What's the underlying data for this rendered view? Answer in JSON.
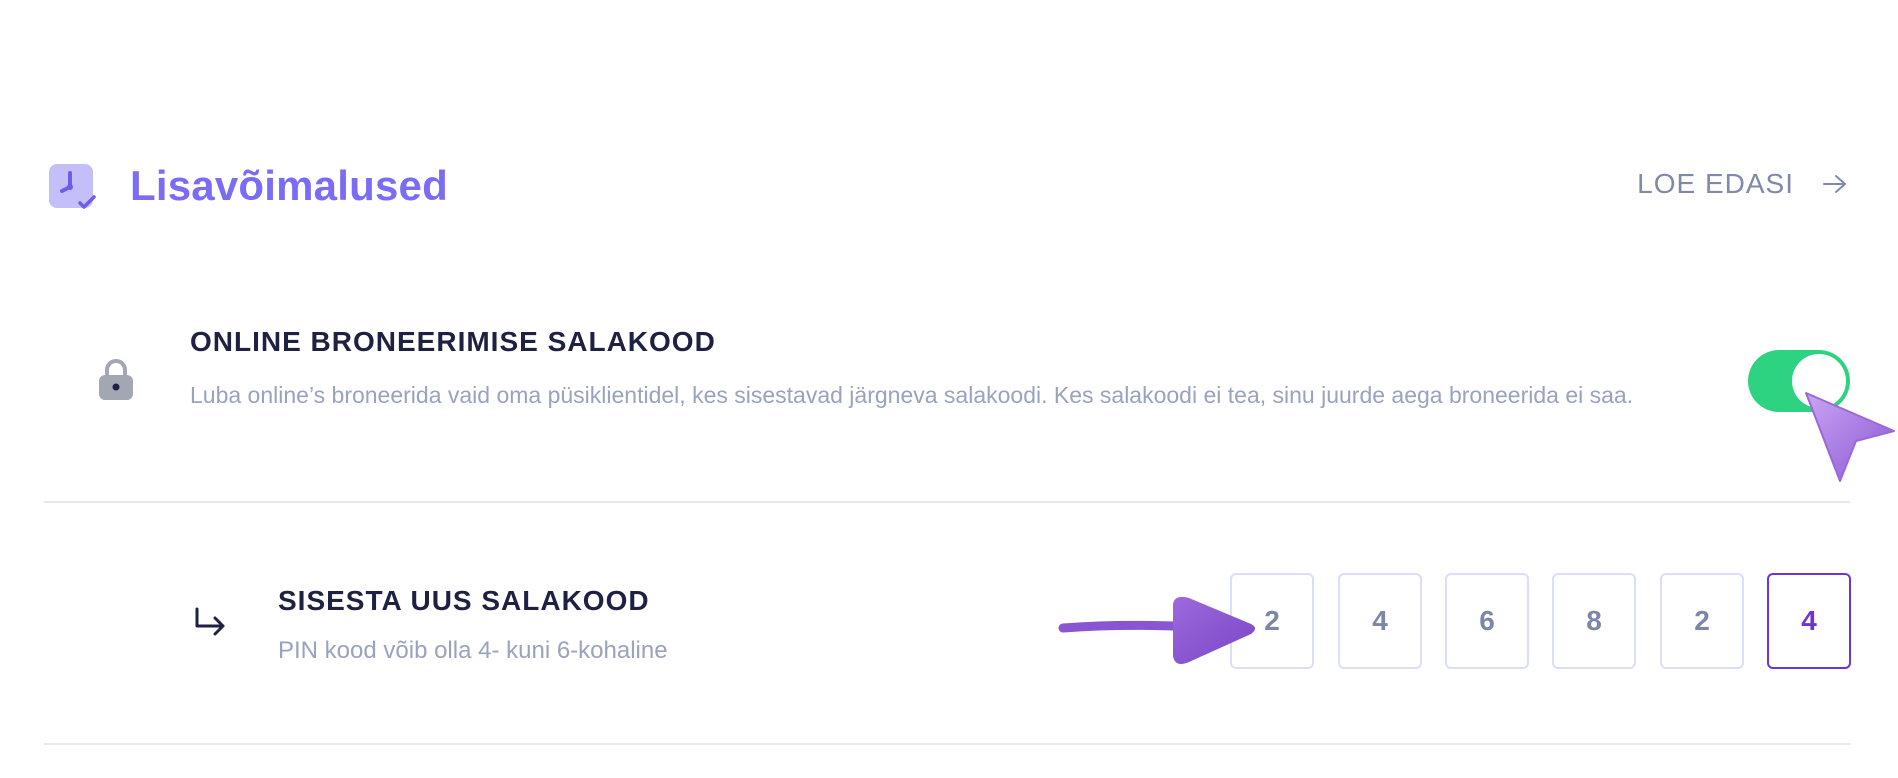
{
  "header": {
    "icon": "clock-check-icon",
    "title": "Lisavõimalused",
    "read_more_label": "LOE EDASI",
    "read_more_icon": "arrow-right-icon"
  },
  "online_passcode": {
    "icon": "lock-icon",
    "title": "ONLINE BRONEERIMISE SALAKOOD",
    "description": "Luba online’s broneerida vaid oma püsiklientidel, kes sisestavad järgneva salakoodi. Kes salakoodi ei tea, sinu juurde aega broneerida ei saa.",
    "toggle_on": true
  },
  "new_passcode": {
    "icon": "return-arrow-icon",
    "title": "SISESTA UUS SALAKOOD",
    "hint": "PIN kood võib olla 4- kuni 6-kohaline",
    "digits": [
      "2",
      "4",
      "6",
      "8",
      "2",
      "4"
    ],
    "active_index": 5
  },
  "colors": {
    "accent": "#7B6CF6",
    "toggle": "#2DD381",
    "active_border": "#6F34D8",
    "text_dark": "#1E2142",
    "text_muted": "#9AA3BC"
  }
}
